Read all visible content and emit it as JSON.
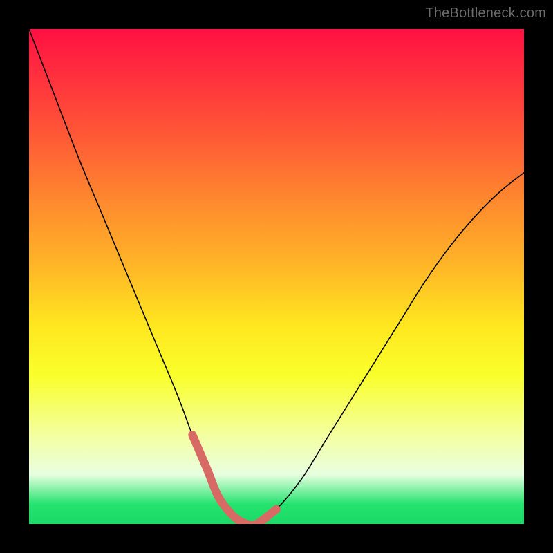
{
  "watermark": "TheBottleneck.com",
  "chart_data": {
    "type": "line",
    "title": "",
    "xlabel": "",
    "ylabel": "",
    "xlim": [
      0,
      100
    ],
    "ylim": [
      0,
      100
    ],
    "series": [
      {
        "name": "bottleneck-curve",
        "stroke": "#000000",
        "stroke_width": 1.6,
        "x": [
          0,
          5,
          10,
          15,
          20,
          25,
          30,
          33,
          36,
          38,
          40,
          42,
          44,
          46,
          50,
          55,
          60,
          65,
          70,
          75,
          80,
          85,
          90,
          95,
          100
        ],
        "y": [
          100,
          87,
          74,
          62,
          50,
          38,
          26,
          18,
          11,
          6,
          3,
          1,
          0,
          0,
          3,
          9,
          17,
          25,
          33,
          41,
          49,
          56,
          62,
          67,
          71
        ]
      },
      {
        "name": "highlight-band",
        "stroke": "#d86a66",
        "stroke_width": 12,
        "linecap": "round",
        "x": [
          33,
          36,
          38,
          40,
          42,
          44,
          46,
          50
        ],
        "y": [
          18,
          11,
          6,
          3,
          1,
          0,
          0,
          3
        ]
      }
    ],
    "gradient_stops": [
      {
        "pos": 0,
        "color": "#ff1042"
      },
      {
        "pos": 60,
        "color": "#ffe71f"
      },
      {
        "pos": 96,
        "color": "#24e36f"
      }
    ]
  }
}
